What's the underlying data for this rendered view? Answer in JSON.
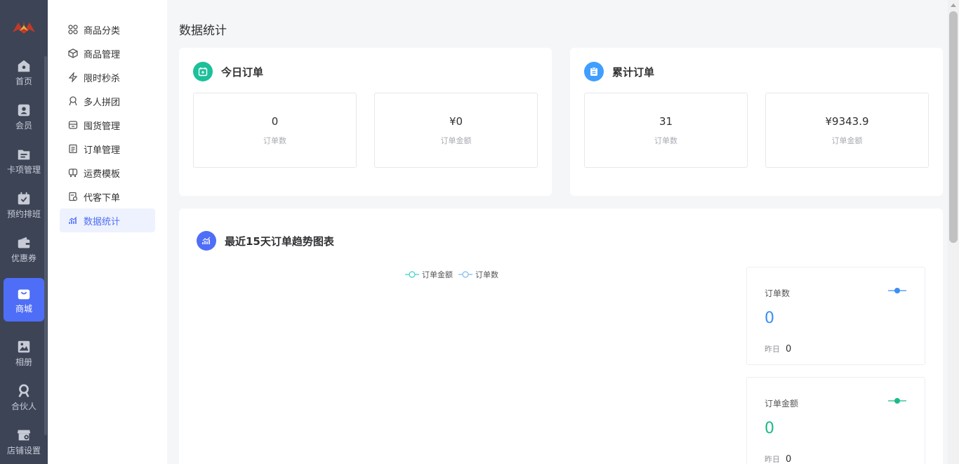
{
  "rail": {
    "items": [
      {
        "label": "首页",
        "icon": "home-icon"
      },
      {
        "label": "会员",
        "icon": "member-card-icon"
      },
      {
        "label": "卡项管理",
        "icon": "folder-list-icon"
      },
      {
        "label": "预约排班",
        "icon": "calendar-check-icon"
      },
      {
        "label": "优惠券",
        "icon": "wallet-icon"
      },
      {
        "label": "商城",
        "icon": "shopping-bag-icon"
      },
      {
        "label": "相册",
        "icon": "image-icon"
      },
      {
        "label": "合伙人",
        "icon": "partner-icon"
      },
      {
        "label": "店铺设置",
        "icon": "store-settings-icon"
      }
    ],
    "active_color": "#4f6ef7"
  },
  "submenu": {
    "items": [
      {
        "label": "商品分类",
        "icon": "grid-icon"
      },
      {
        "label": "商品管理",
        "icon": "cube-icon"
      },
      {
        "label": "限时秒杀",
        "icon": "lightning-icon"
      },
      {
        "label": "多人拼团",
        "icon": "group-icon"
      },
      {
        "label": "囤货管理",
        "icon": "store-box-icon"
      },
      {
        "label": "订单管理",
        "icon": "document-icon"
      },
      {
        "label": "运费模板",
        "icon": "truck-icon"
      },
      {
        "label": "代客下单",
        "icon": "proxy-order-icon"
      },
      {
        "label": "数据统计",
        "icon": "bar-chart-icon"
      }
    ]
  },
  "page": {
    "title": "数据统计"
  },
  "today": {
    "title": "今日订单",
    "order_count": "0",
    "order_count_label": "订单数",
    "order_amount": "¥0",
    "order_amount_label": "订单金额",
    "icon_color": "#1cc09a"
  },
  "total": {
    "title": "累计订单",
    "order_count": "31",
    "order_count_label": "订单数",
    "order_amount": "¥9343.9",
    "order_amount_label": "订单金额",
    "icon_color": "#409eff"
  },
  "trend": {
    "title": "最近15天订单趋势图表",
    "legend": [
      {
        "name": "订单金额",
        "color": "#3ad3c3"
      },
      {
        "name": "订单数",
        "color": "#7dbbef"
      }
    ],
    "icon_color": "#4f6ef7"
  },
  "side_cards": [
    {
      "title": "订单数",
      "value": "0",
      "yesterday_label": "昨日",
      "yesterday_value": "0",
      "color": "#3a8ef6"
    },
    {
      "title": "订单金额",
      "value": "0",
      "yesterday_label": "昨日",
      "yesterday_value": "0",
      "color": "#1cb98a"
    }
  ]
}
